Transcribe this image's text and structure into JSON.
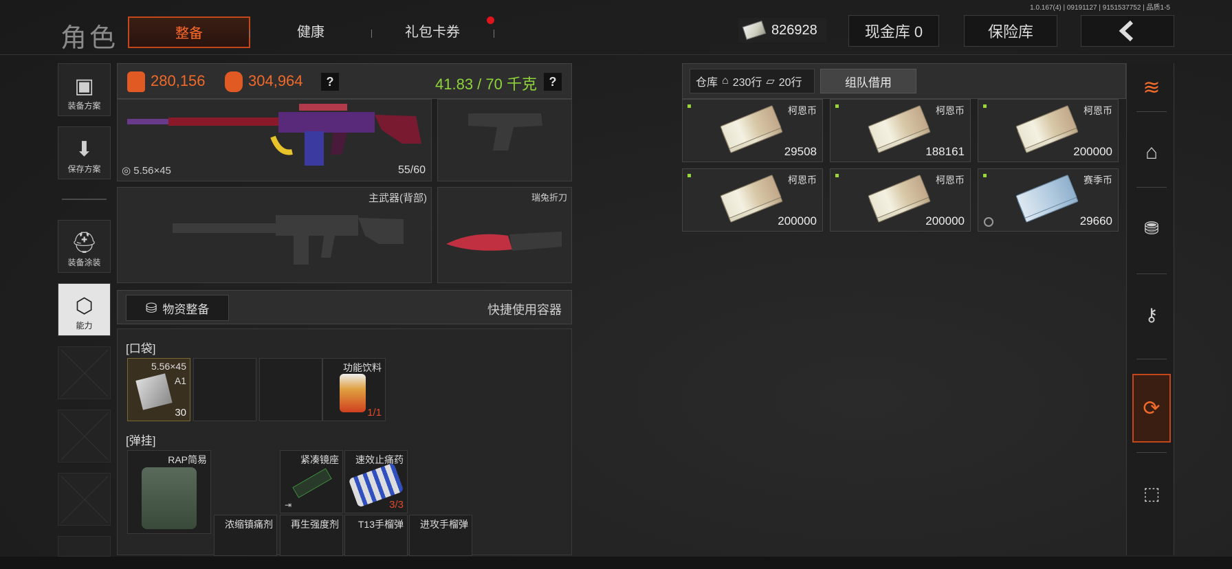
{
  "version": "1.0.167(4) | 09191127 | 9151537752 | 品质1-5",
  "header": {
    "title": "角色",
    "tabs": [
      {
        "label": "整备",
        "active": true
      },
      {
        "label": "健康",
        "active": false
      },
      {
        "label": "礼包卡券",
        "active": false
      }
    ],
    "money": "826928",
    "cash_vault": "现金库 0",
    "safe_box": "保险库"
  },
  "sidenav": [
    {
      "label": "装备方案",
      "icon": "vest-icon"
    },
    {
      "label": "保存方案",
      "icon": "download-icon"
    },
    {
      "label": "装备涂装",
      "icon": "helmet-paint-icon"
    },
    {
      "label": "能力",
      "icon": "ability-icon",
      "active": true
    }
  ],
  "loadout": {
    "armor_value": "280,156",
    "bag_value": "304,964",
    "weight": "41.83 / 70 千克",
    "primary_weapon": {
      "caliber": "5.56×45",
      "ammo": "55/60"
    },
    "secondary_slot_label": "主武器(背部)",
    "knife_label": "瑞兔折刀"
  },
  "supplies": {
    "button": "物资整备",
    "quick_container": "快捷使用容器",
    "pocket_label": "口袋",
    "pocket_items": [
      {
        "name": "5.56×45",
        "sub": "A1",
        "count": "30"
      },
      {
        "name": "功能饮料",
        "count": "1/1"
      }
    ],
    "rig_label": "弹挂",
    "rig_items": [
      {
        "name": "RAP简易"
      },
      {
        "name": "紧凑镜座"
      },
      {
        "name": "速效止痛药",
        "count": "3/3"
      },
      {
        "name": "浓缩镇痛剂"
      },
      {
        "name": "再生强度剂"
      },
      {
        "name": "T13手榴弹"
      },
      {
        "name": "进攻手榴弹"
      }
    ]
  },
  "warehouse": {
    "label": "仓库",
    "rows_home": "230行",
    "rows_ticket": "20行",
    "team_borrow": "组队借用",
    "items": [
      {
        "name": "柯恩币",
        "amount": "29508"
      },
      {
        "name": "柯恩币",
        "amount": "188161"
      },
      {
        "name": "柯恩币",
        "amount": "200000"
      },
      {
        "name": "柯恩币",
        "amount": "200000"
      },
      {
        "name": "柯恩币",
        "amount": "200000"
      },
      {
        "name": "赛季币",
        "amount": "29660"
      }
    ]
  },
  "rail": [
    "sort-icon",
    "home-icon",
    "exchange-icon",
    "key-icon",
    "loot-icon",
    "box-icon"
  ],
  "colors": {
    "accent": "#f26a2a",
    "weight_ok": "#8fd43a",
    "notify": "#e0141c"
  }
}
